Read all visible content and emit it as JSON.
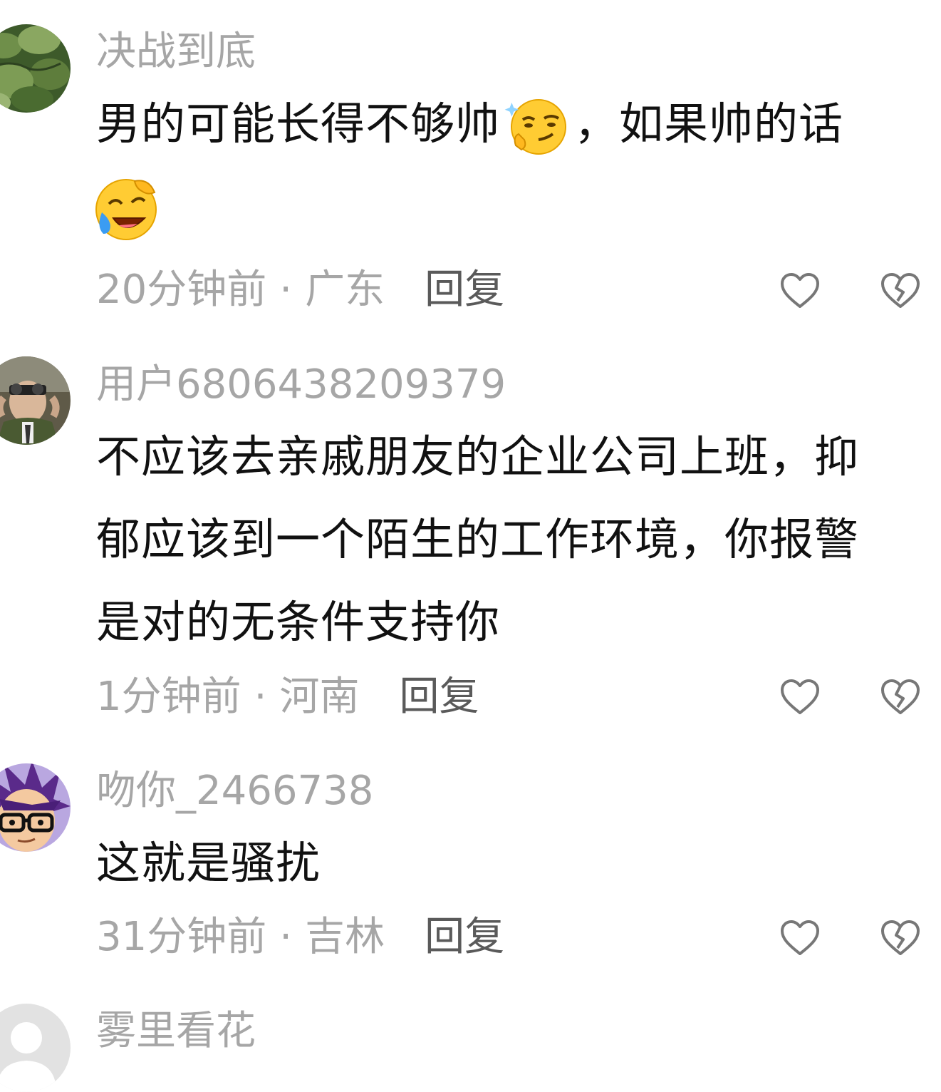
{
  "comments": [
    {
      "username": "决战到底",
      "content_line1_before": "男的可能长得不够帅",
      "content_line1_after": "，如果帅的话",
      "time": "20分钟前",
      "dot": "·",
      "location": "广东",
      "reply_label": "回复",
      "avatar": "plant-photo-avatar",
      "emojis": [
        "thinking-smirk-emoji",
        "rofl-emoji"
      ]
    },
    {
      "username": "用户6806438209379",
      "content_lines": [
        "不应该去亲戚朋友的企业公司上班，抑",
        "郁应该到一个陌生的工作环境，你报警",
        "是对的无条件支持你"
      ],
      "time": "1分钟前",
      "dot": "·",
      "location": "河南",
      "reply_label": "回复",
      "avatar": "man-with-binoculars-avatar"
    },
    {
      "username": "吻你_2466738",
      "content_lines": [
        "这就是骚扰"
      ],
      "time": "31分钟前",
      "dot": "·",
      "location": "吉林",
      "reply_label": "回复",
      "avatar": "cartoon-man-glasses-avatar"
    },
    {
      "username": "雾里看花",
      "avatar": "default-gray-avatar"
    }
  ],
  "colors": {
    "username": "#a6a6a6",
    "content": "#111111",
    "meta": "#a6a6a6",
    "reply": "#5a5a5a",
    "icon": "#777777"
  },
  "icons": {
    "like": "heart-outline-icon",
    "dislike": "broken-heart-outline-icon"
  }
}
